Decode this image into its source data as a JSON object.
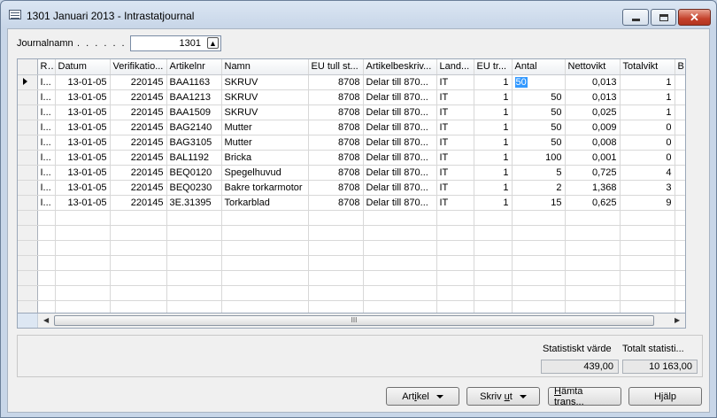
{
  "window": {
    "title": "1301 Januari 2013 - Intrastatjournal",
    "controls": {
      "minimize": "minimize",
      "maximize": "maximize",
      "close": "✕"
    }
  },
  "journal": {
    "label": "Journalnamn",
    "dots": ". . . . . .",
    "value": "1301",
    "lookup_icon": "arrow-up-lookup-icon"
  },
  "grid": {
    "columns": [
      "R...",
      "Datum",
      "Verifikatio...",
      "Artikelnr",
      "Namn",
      "EU tull st...",
      "Artikelbeskriv...",
      "Land...",
      "EU tr...",
      "Antal",
      "Nettovikt",
      "Totalvikt",
      "Be"
    ],
    "rows": [
      [
        "I...",
        "13-01-05",
        "220145",
        "BAA1163",
        "SKRUV",
        "8708",
        "Delar till 870...",
        "IT",
        "1",
        "50",
        "0,013",
        "1",
        ""
      ],
      [
        "I...",
        "13-01-05",
        "220145",
        "BAA1213",
        "SKRUV",
        "8708",
        "Delar till 870...",
        "IT",
        "1",
        "50",
        "0,013",
        "1",
        ""
      ],
      [
        "I...",
        "13-01-05",
        "220145",
        "BAA1509",
        "SKRUV",
        "8708",
        "Delar till 870...",
        "IT",
        "1",
        "50",
        "0,025",
        "1",
        ""
      ],
      [
        "I...",
        "13-01-05",
        "220145",
        "BAG2140",
        "Mutter",
        "8708",
        "Delar till 870...",
        "IT",
        "1",
        "50",
        "0,009",
        "0",
        ""
      ],
      [
        "I...",
        "13-01-05",
        "220145",
        "BAG3105",
        "Mutter",
        "8708",
        "Delar till 870...",
        "IT",
        "1",
        "50",
        "0,008",
        "0",
        ""
      ],
      [
        "I...",
        "13-01-05",
        "220145",
        "BAL1192",
        "Bricka",
        "8708",
        "Delar till 870...",
        "IT",
        "1",
        "100",
        "0,001",
        "0",
        ""
      ],
      [
        "I...",
        "13-01-05",
        "220145",
        "BEQ0120",
        "Spegelhuvud",
        "8708",
        "Delar till 870...",
        "IT",
        "1",
        "5",
        "0,725",
        "4",
        ""
      ],
      [
        "I...",
        "13-01-05",
        "220145",
        "BEQ0230",
        "Bakre torkarmotor",
        "8708",
        "Delar till 870...",
        "IT",
        "1",
        "2",
        "1,368",
        "3",
        ""
      ],
      [
        "I...",
        "13-01-05",
        "220145",
        "3E.31395",
        "Torkarblad",
        "8708",
        "Delar till 870...",
        "IT",
        "1",
        "15",
        "0,625",
        "9",
        ""
      ]
    ],
    "empty_rows": 7
  },
  "scrollbar": {
    "thumb_grip": "III"
  },
  "totals": {
    "stat_value_label": "Statistiskt värde",
    "stat_value": "439,00",
    "total_stat_label": "Totalt statisti...",
    "total_stat_value": "10 163,00"
  },
  "buttons": {
    "artikel_pre": "Art",
    "artikel_u": "i",
    "artikel_post": "kel",
    "skriv_pre": "Skriv ",
    "skriv_u": "u",
    "skriv_post": "t",
    "hamta_pre": "",
    "hamta_u": "H",
    "hamta_post": "ämta trans...",
    "hjalp": "Hjälp"
  }
}
